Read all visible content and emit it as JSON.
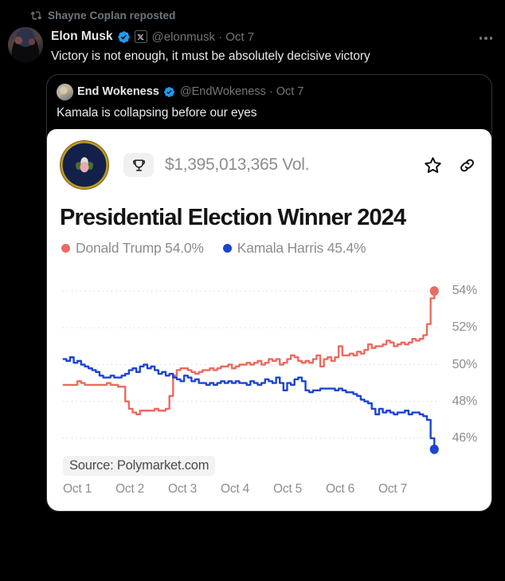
{
  "repost": {
    "label": "Shayne Coplan reposted",
    "icon": "repost-icon"
  },
  "tweet": {
    "display_name": "Elon Musk",
    "verified_icon": "verified-badge-icon",
    "affiliate_icon": "x-affiliate-badge-icon",
    "handle_meta": "@elonmusk · Oct 7",
    "text": "Victory is not enough, it must be absolutely decisive victory",
    "more_icon": "more-options-icon",
    "avatar": "avatar"
  },
  "quote": {
    "display_name": "End Wokeness",
    "verified_icon": "verified-badge-icon",
    "handle_meta": "@EndWokeness · Oct 7",
    "text": "Kamala is collapsing before our eyes",
    "avatar": "avatar"
  },
  "market": {
    "seal_icon": "presidential-seal-icon",
    "trophy_icon": "trophy-icon",
    "volume": "$1,395,013,365 Vol.",
    "star_icon": "star-icon",
    "link_icon": "link-icon",
    "title": "Presidential Election Winner 2024",
    "source": "Source: Polymarket.com",
    "legend": [
      {
        "label": "Donald Trump 54.0%",
        "color": "#ec6a5e"
      },
      {
        "label": "Kamala Harris 45.4%",
        "color": "#1b44d4"
      }
    ]
  },
  "chart_data": {
    "type": "line",
    "title": "Presidential Election Winner 2024",
    "xlabel": "",
    "ylabel": "",
    "ylim": [
      45.0,
      55.0
    ],
    "yticks": [
      54,
      52,
      50,
      48,
      46
    ],
    "ytick_labels": [
      "54%",
      "52%",
      "50%",
      "48%",
      "46%"
    ],
    "grid": "dotted-horizontal",
    "legend_position": "top-left",
    "x": [
      "Oct 1",
      "Oct 2",
      "Oct 3",
      "Oct 4",
      "Oct 5",
      "Oct 6",
      "Oct 7"
    ],
    "xtick_labels": [
      "Oct 1",
      "Oct 2",
      "Oct 3",
      "Oct 4",
      "Oct 5",
      "Oct 6",
      "Oct 7"
    ],
    "annotations": [
      "Source: Polymarket.com"
    ],
    "series": [
      {
        "name": "Donald Trump",
        "color": "#ec6a5e",
        "end_label": "54.0%",
        "end_marker": true,
        "values": [
          48.9,
          48.9,
          48.9,
          48.9,
          49.1,
          49.0,
          48.9,
          48.9,
          48.9,
          48.9,
          48.9,
          48.9,
          49.0,
          48.9,
          48.9,
          48.8,
          48.8,
          48.0,
          47.6,
          47.4,
          47.3,
          47.5,
          47.5,
          47.5,
          47.5,
          47.6,
          47.5,
          47.5,
          47.6,
          48.3,
          49.4,
          49.7,
          49.8,
          49.8,
          49.7,
          49.6,
          49.5,
          49.6,
          49.7,
          49.7,
          49.8,
          49.7,
          49.8,
          49.9,
          49.9,
          50.0,
          49.8,
          49.9,
          50.0,
          50.0,
          50.1,
          50.0,
          50.1,
          50.2,
          50.0,
          50.1,
          50.3,
          50.2,
          50.3,
          50.0,
          50.1,
          50.3,
          50.5,
          50.4,
          50.2,
          50.1,
          50.2,
          50.1,
          50.3,
          50.5,
          49.9,
          50.3,
          50.4,
          50.2,
          50.4,
          51.0,
          50.5,
          50.5,
          50.6,
          50.5,
          50.7,
          50.6,
          50.8,
          51.1,
          50.9,
          51.0,
          51.0,
          51.1,
          51.3,
          51.2,
          51.0,
          51.1,
          51.2,
          51.1,
          51.2,
          51.4,
          51.3,
          51.4,
          51.6,
          52.2,
          53.6,
          54.0
        ]
      },
      {
        "name": "Kamala Harris",
        "color": "#1b44d4",
        "end_label": "45.4%",
        "end_marker": true,
        "values": [
          50.3,
          50.2,
          50.4,
          50.1,
          50.2,
          50.0,
          49.9,
          49.8,
          49.7,
          49.6,
          49.4,
          49.3,
          49.3,
          49.4,
          49.3,
          49.3,
          49.4,
          49.5,
          49.7,
          49.8,
          49.6,
          49.9,
          50.0,
          49.8,
          49.9,
          49.7,
          49.5,
          49.6,
          49.4,
          49.5,
          49.3,
          49.2,
          49.1,
          49.4,
          49.3,
          49.1,
          49.2,
          49.0,
          49.0,
          48.9,
          49.0,
          48.9,
          49.0,
          49.1,
          49.0,
          49.1,
          49.0,
          49.1,
          49.0,
          49.0,
          48.9,
          49.1,
          49.0,
          48.9,
          49.0,
          49.2,
          49.1,
          49.0,
          49.3,
          49.0,
          48.6,
          49.0,
          48.9,
          49.2,
          49.3,
          49.1,
          48.6,
          48.5,
          48.6,
          48.6,
          48.7,
          48.7,
          48.7,
          48.7,
          48.6,
          48.7,
          48.6,
          48.5,
          48.5,
          48.4,
          48.3,
          48.1,
          48.0,
          47.9,
          47.6,
          47.3,
          47.6,
          47.4,
          47.5,
          47.4,
          47.3,
          47.4,
          47.4,
          47.5,
          47.3,
          47.4,
          47.4,
          47.3,
          47.2,
          47.0,
          46.0,
          45.4
        ]
      }
    ]
  }
}
